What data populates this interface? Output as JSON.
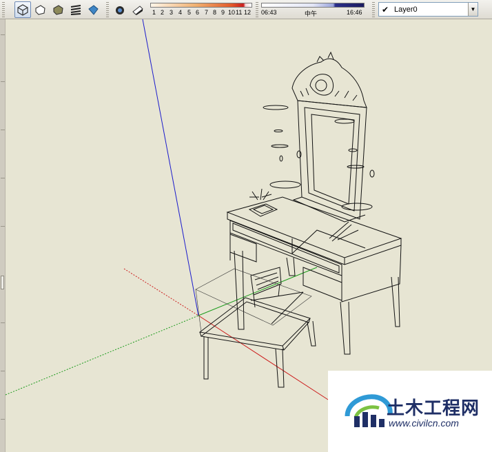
{
  "toolbar": {
    "style_buttons": [
      {
        "name": "xray-style-icon",
        "active": true
      },
      {
        "name": "wireframe-style-icon",
        "active": false
      },
      {
        "name": "hidden-line-style-icon",
        "active": false
      },
      {
        "name": "shaded-style-icon",
        "active": false
      },
      {
        "name": "shaded-textures-style-icon",
        "active": false
      }
    ],
    "shadow_buttons": [
      {
        "name": "shadow-settings-icon"
      },
      {
        "name": "display-shadows-icon"
      }
    ],
    "month_scale": [
      "1",
      "2",
      "3",
      "4",
      "5",
      "6",
      "7",
      "8",
      "9",
      "10",
      "11",
      "12"
    ],
    "time_scale": {
      "start": "06:43",
      "mid": "中午",
      "end": "16:46"
    }
  },
  "layer": {
    "name": "Layer0",
    "checked": true
  },
  "watermark": {
    "title": "土木工程网",
    "url": "www.civilcn.com"
  },
  "colors": {
    "viewport_bg": "#e7e5d3",
    "axis_blue": "#1a1acc",
    "axis_red": "#cc1a1a",
    "axis_green": "#1a9a1a",
    "model_line": "#111111"
  }
}
